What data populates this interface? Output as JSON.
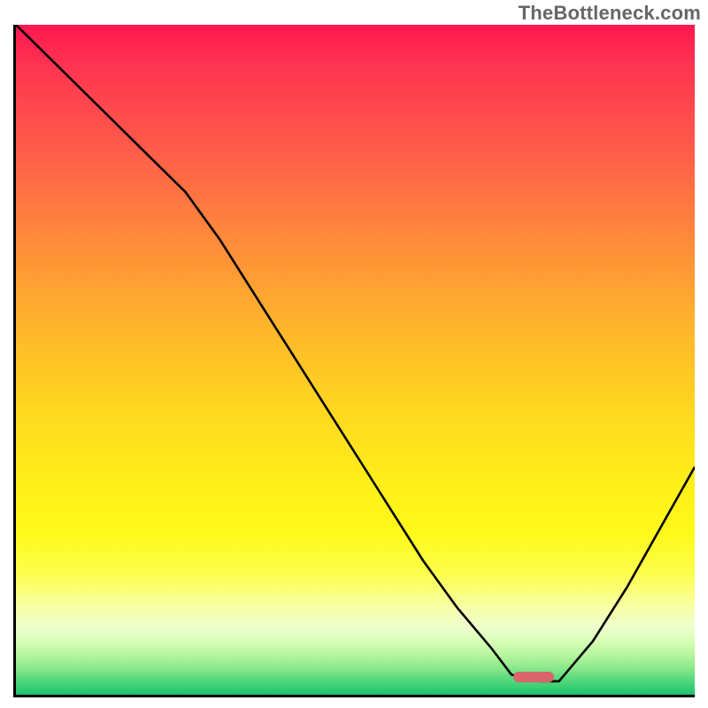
{
  "watermark": "TheBottleneck.com",
  "chart_data": {
    "type": "line",
    "title": "",
    "xlabel": "",
    "ylabel": "",
    "xlim": [
      0,
      100
    ],
    "ylim": [
      0,
      100
    ],
    "grid": false,
    "legend": false,
    "series": [
      {
        "name": "curve",
        "x": [
          0,
          5,
          10,
          15,
          20,
          25,
          30,
          35,
          40,
          45,
          50,
          55,
          60,
          65,
          70,
          73,
          77,
          80,
          85,
          90,
          95,
          100
        ],
        "values": [
          100,
          95,
          90,
          85,
          80,
          75,
          68,
          60,
          52,
          44,
          36,
          28,
          20,
          13,
          7,
          3,
          2,
          2,
          8,
          16,
          25,
          34
        ]
      }
    ],
    "marker": {
      "x": 76,
      "width_pct": 6
    },
    "stroke": "#000000",
    "stroke_width": 2.6
  }
}
